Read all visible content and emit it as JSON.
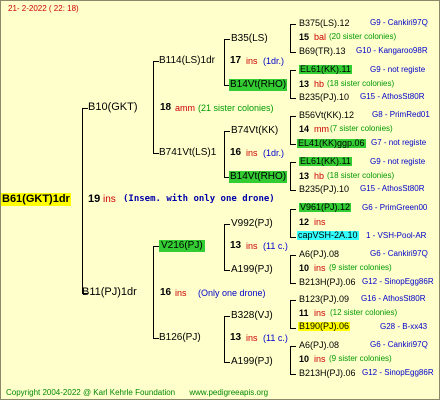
{
  "header": {
    "date_code": "21-  2-2022 (  22:  18)"
  },
  "root": {
    "name": "B61(GKT)1dr",
    "count": "19",
    "ins": "ins",
    "note": "(Insem. with only one drone)"
  },
  "gen1": [
    {
      "name": "B10(GKT)",
      "count": "18",
      "suffix": "amm",
      "sisters": "(21 sister colonies)"
    },
    {
      "name": "B11(PJ)1dr",
      "count": "16",
      "suffix": "ins",
      "sisters": "(Only one drone)"
    }
  ],
  "gen2": [
    {
      "name": "B114(LS)1dr",
      "count": "17",
      "suffix": "ins",
      "sisters": "(1dr.)"
    },
    {
      "name": "B741Vt(LS)1",
      "count": "16",
      "suffix": "ins",
      "sisters": "(1dr.)"
    },
    {
      "name": "V216(PJ)",
      "count": "13",
      "suffix": "ins",
      "sisters": "(11 c.)"
    },
    {
      "name": "B126(PJ)",
      "count": "13",
      "suffix": "ins",
      "sisters": "(11 c.)"
    }
  ],
  "gen3": [
    {
      "name": "B35(LS)"
    },
    {
      "name": "B14Vt(RHO)"
    },
    {
      "name": "B74Vt(KK)"
    },
    {
      "name": "B14Vt(RHO)"
    },
    {
      "name": "V992(PJ)"
    },
    {
      "name": "A199(PJ)"
    },
    {
      "name": "B328(VJ)"
    },
    {
      "name": "A199(PJ)"
    }
  ],
  "gen4": [
    {
      "top": "B375(LS).12",
      "top_right": "G9 - Cankiri97Q",
      "mid_count": "15",
      "mid_suffix": "bal",
      "mid_sisters": "(20 sister colonies)",
      "bot": "B69(TR).13",
      "bot_right": "G10 - Kangaroo98R"
    },
    {
      "top": "EL61(KK).11",
      "top_right": "G9 - not registe",
      "mid_count": "13",
      "mid_suffix": "hb",
      "mid_sisters": "(18 sister colonies)",
      "bot": "B235(PJ).10",
      "bot_right": "G15 - AthosSt80R"
    },
    {
      "top": "B56Vt(KK).12",
      "top_right": "G8 - PrimRed01",
      "mid_count": "14",
      "mid_suffix": "mm",
      "mid_sisters": "(7 sister colonies)",
      "bot": "EL41(KK)ggp.06",
      "bot_right": "G7 - not registe"
    },
    {
      "top": "EL61(KK).11",
      "top_right": "G9 - not registe",
      "mid_count": "13",
      "mid_suffix": "hb",
      "mid_sisters": "(18 sister colonies)",
      "bot": "B235(PJ).10",
      "bot_right": "G15 - AthosSt80R"
    },
    {
      "top": "V961(PJ).12",
      "top_right": "G6 - PrimGreen00",
      "mid_count": "12",
      "mid_suffix": "ins",
      "mid_sisters": "",
      "bot": "capVSH-2A.10",
      "bot_right": "1 - VSH-Pool-AR"
    },
    {
      "top": "A6(PJ).08",
      "top_right": "G6 - Cankiri97Q",
      "mid_count": "10",
      "mid_suffix": "ins",
      "mid_sisters": "(9 sister colonies)",
      "bot": "B213H(PJ).06",
      "bot_right": "G12 - SinopEgg86R"
    },
    {
      "top": "B123(PJ).09",
      "top_right": "G16 - AthosSt80R",
      "mid_count": "11",
      "mid_suffix": "ins",
      "mid_sisters": "(12 sister colonies)",
      "bot": "B190(PJ).06",
      "bot_right": "G28 - B-xx43"
    },
    {
      "top": "A6(PJ).08",
      "top_right": "G6 - Cankiri97Q",
      "mid_count": "10",
      "mid_suffix": "ins",
      "mid_sisters": "(9 sister colonies)",
      "bot": "B213H(PJ).06",
      "bot_right": "G12 - SinopEgg86R"
    }
  ],
  "footer": {
    "copyright": "Copyright 2004-2022 @ Karl Kehrle Foundation",
    "site": "www.pedigreeapis.org"
  },
  "colors": {
    "background": "#ffffcc",
    "highlight_green": "#33cc33",
    "highlight_cyan": "#33ffff",
    "highlight_yellow": "#ffff00",
    "count_red": "#cc0000",
    "gen_blue": "#0000cc",
    "sisters_green": "#009900"
  }
}
